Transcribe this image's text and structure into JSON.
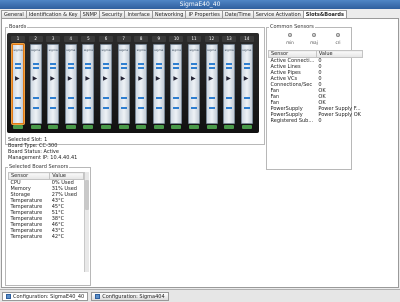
{
  "window": {
    "title": "SigmaE40_40"
  },
  "tabs": [
    {
      "label": "General"
    },
    {
      "label": "Identification & Key"
    },
    {
      "label": "SNMP"
    },
    {
      "label": "Security"
    },
    {
      "label": "Interface"
    },
    {
      "label": "Networking"
    },
    {
      "label": "IP Properties"
    },
    {
      "label": "Date/Time"
    },
    {
      "label": "Service Activation"
    },
    {
      "label": "Slots&Boards"
    }
  ],
  "boards": {
    "group_label": "Boards",
    "slots": [
      {
        "num": "1",
        "label": "sigma"
      },
      {
        "num": "2",
        "label": "sigma"
      },
      {
        "num": "3",
        "label": "sigma"
      },
      {
        "num": "4",
        "label": "sigma"
      },
      {
        "num": "5",
        "label": "sigma"
      },
      {
        "num": "6",
        "label": "sigma"
      },
      {
        "num": "7",
        "label": "sigma"
      },
      {
        "num": "8",
        "label": "sigma"
      },
      {
        "num": "9",
        "label": "sigma"
      },
      {
        "num": "10",
        "label": "sigma"
      },
      {
        "num": "11",
        "label": "sigma"
      },
      {
        "num": "12",
        "label": "sigma"
      },
      {
        "num": "13",
        "label": "sigma"
      },
      {
        "num": "14",
        "label": "sigma"
      }
    ],
    "selected_slot_index": 0,
    "slot_color": "#2f7fd0",
    "selected_color": "#e07a18"
  },
  "board_info": {
    "selected_slot": "Selected Slot: 1",
    "board_type": "Board Type: CC-300",
    "board_status": "Board Status: Active",
    "management_ip": "Management IP: 10.4.40.41"
  },
  "board_sensors": {
    "group_label": "Selected Board Sensors",
    "headers": [
      "Sensor",
      "Value"
    ],
    "rows": [
      [
        "CPU",
        "0% Used"
      ],
      [
        "Memory",
        "31% Used"
      ],
      [
        "Storage",
        "27% Used"
      ],
      [
        "Temperature",
        "43°C"
      ],
      [
        "Temperature",
        "45°C"
      ],
      [
        "Temperature",
        "51°C"
      ],
      [
        "Temperature",
        "38°C"
      ],
      [
        "Temperature",
        "46°C"
      ],
      [
        "Temperature",
        "43°C"
      ],
      [
        "Temperature",
        "42°C"
      ]
    ]
  },
  "common_sensors": {
    "group_label": "Common Sensors",
    "alarms": [
      "min",
      "maj",
      "cri"
    ],
    "headers": [
      "Sensor",
      "Value"
    ],
    "rows": [
      [
        "Active Connecti...",
        "0"
      ],
      [
        "Active Lines",
        "0"
      ],
      [
        "Active Pipes",
        "0"
      ],
      [
        "Active VCs",
        "0"
      ],
      [
        "Connections/Sec",
        "0"
      ],
      [
        "Fan",
        "OK"
      ],
      [
        "Fan",
        "OK"
      ],
      [
        "Fan",
        "OK"
      ],
      [
        "PowerSupply",
        "Power Supply F..."
      ],
      [
        "PowerSupply",
        "Power Supply OK"
      ],
      [
        "Registered Sub...",
        "0"
      ]
    ]
  },
  "bottom_tabs": [
    {
      "label": "Configuration: SigmaE40_40"
    },
    {
      "label": "Configuration: Sigma404"
    }
  ]
}
